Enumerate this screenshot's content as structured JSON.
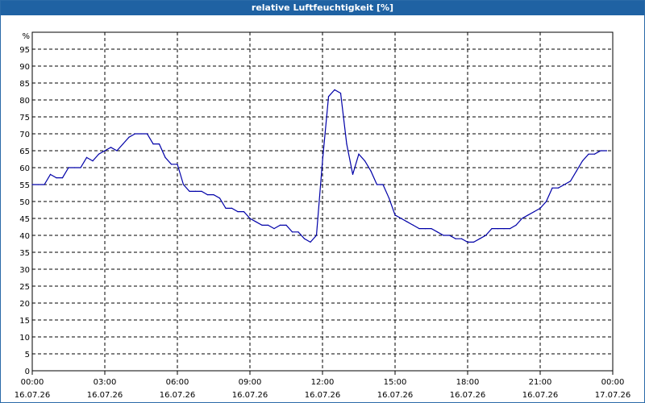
{
  "window": {
    "title": "relative Luftfeuchtigkeit [%]"
  },
  "colors": {
    "titlebar": "#1f62a3",
    "line": "#0000a8",
    "grid": "#000000",
    "frame": "#2a6aa8"
  },
  "chart_data": {
    "type": "line",
    "title": "relative Luftfeuchtigkeit [%]",
    "ylabel": "%",
    "xlabel": "",
    "ylim": [
      0,
      100
    ],
    "yticks": [
      0,
      5,
      10,
      15,
      20,
      25,
      30,
      35,
      40,
      45,
      50,
      55,
      60,
      65,
      70,
      75,
      80,
      85,
      90,
      95
    ],
    "grid": true,
    "legend": "none",
    "xticks": [
      {
        "time": "00:00",
        "date": "16.07.26"
      },
      {
        "time": "03:00",
        "date": "16.07.26"
      },
      {
        "time": "06:00",
        "date": "16.07.26"
      },
      {
        "time": "09:00",
        "date": "16.07.26"
      },
      {
        "time": "12:00",
        "date": "16.07.26"
      },
      {
        "time": "15:00",
        "date": "16.07.26"
      },
      {
        "time": "18:00",
        "date": "16.07.26"
      },
      {
        "time": "21:00",
        "date": "16.07.26"
      },
      {
        "time": "00:00",
        "date": "17.07.26"
      }
    ],
    "series": [
      {
        "x": [
          "16.07.26 00:00",
          "16.07.26 00:15",
          "16.07.26 00:30",
          "16.07.26 00:45",
          "16.07.26 01:00",
          "16.07.26 01:15",
          "16.07.26 01:30",
          "16.07.26 01:45",
          "16.07.26 02:00",
          "16.07.26 02:15",
          "16.07.26 02:30",
          "16.07.26 02:45",
          "16.07.26 03:00",
          "16.07.26 03:15",
          "16.07.26 03:30",
          "16.07.26 03:45",
          "16.07.26 04:00",
          "16.07.26 04:15",
          "16.07.26 04:30",
          "16.07.26 04:45",
          "16.07.26 05:00",
          "16.07.26 05:15",
          "16.07.26 05:30",
          "16.07.26 05:45",
          "16.07.26 06:00",
          "16.07.26 06:15",
          "16.07.26 06:30",
          "16.07.26 06:45",
          "16.07.26 07:00",
          "16.07.26 07:15",
          "16.07.26 07:30",
          "16.07.26 07:45",
          "16.07.26 08:00",
          "16.07.26 08:15",
          "16.07.26 08:30",
          "16.07.26 08:45",
          "16.07.26 09:00",
          "16.07.26 09:15",
          "16.07.26 09:30",
          "16.07.26 09:45",
          "16.07.26 10:00",
          "16.07.26 10:15",
          "16.07.26 10:30",
          "16.07.26 10:45",
          "16.07.26 11:00",
          "16.07.26 11:15",
          "16.07.26 11:30",
          "16.07.26 11:45",
          "16.07.26 12:00",
          "16.07.26 12:15",
          "16.07.26 12:30",
          "16.07.26 12:45",
          "16.07.26 13:00",
          "16.07.26 13:15",
          "16.07.26 13:30",
          "16.07.26 13:45",
          "16.07.26 14:00",
          "16.07.26 14:15",
          "16.07.26 14:30",
          "16.07.26 14:45",
          "16.07.26 15:00",
          "16.07.26 15:15",
          "16.07.26 15:30",
          "16.07.26 15:45",
          "16.07.26 16:00",
          "16.07.26 16:15",
          "16.07.26 16:30",
          "16.07.26 16:45",
          "16.07.26 17:00",
          "16.07.26 17:15",
          "16.07.26 17:30",
          "16.07.26 17:45",
          "16.07.26 18:00",
          "16.07.26 18:15",
          "16.07.26 18:30",
          "16.07.26 18:45",
          "16.07.26 19:00",
          "16.07.26 19:15",
          "16.07.26 19:30",
          "16.07.26 19:45",
          "16.07.26 20:00",
          "16.07.26 20:15",
          "16.07.26 20:30",
          "16.07.26 20:45",
          "16.07.26 21:00",
          "16.07.26 21:15",
          "16.07.26 21:30",
          "16.07.26 21:45",
          "16.07.26 22:00",
          "16.07.26 22:15",
          "16.07.26 22:30",
          "16.07.26 22:45",
          "16.07.26 23:00",
          "16.07.26 23:15",
          "16.07.26 23:30",
          "16.07.26 23:45"
        ],
        "y": [
          55,
          55,
          55,
          58,
          57,
          57,
          60,
          60,
          60,
          63,
          62,
          64,
          65,
          66,
          65,
          67,
          69,
          70,
          70,
          70,
          67,
          67,
          63,
          61,
          61,
          55,
          53,
          53,
          53,
          52,
          52,
          51,
          48,
          48,
          47,
          47,
          45,
          44,
          43,
          43,
          42,
          43,
          43,
          41,
          41,
          39,
          38,
          40,
          62,
          81,
          83,
          82,
          67,
          58,
          64,
          62,
          59,
          55,
          55,
          51,
          46,
          45,
          44,
          43,
          42,
          42,
          42,
          41,
          40,
          40,
          39,
          39,
          38,
          38,
          39,
          40,
          42,
          42,
          42,
          42,
          43,
          45,
          46,
          47,
          48,
          50,
          54,
          54,
          55,
          56,
          59,
          62,
          64,
          64,
          65,
          65
        ]
      }
    ]
  }
}
